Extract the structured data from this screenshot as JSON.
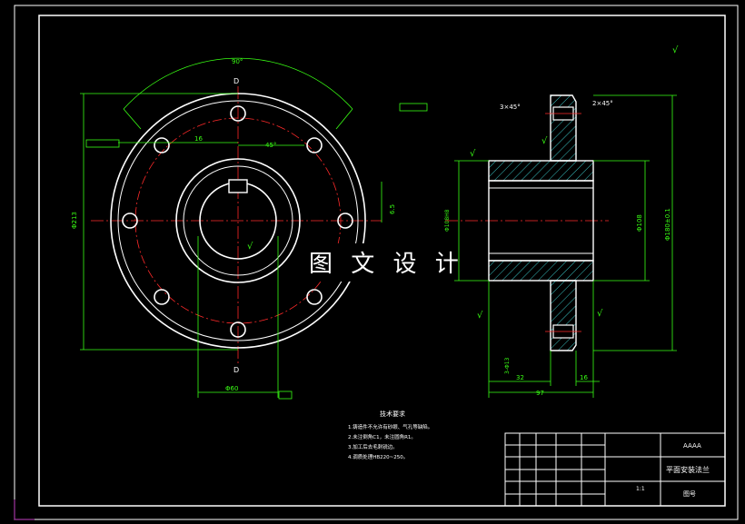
{
  "watermark": "图 文 设 计",
  "front_view": {
    "angle_label": "90°",
    "bolt_angle_label": "45°",
    "outer_dia_label": "Φ213",
    "bolt_circle_label": "Φ60",
    "pitch_label": "16",
    "keyway_label": "6.5",
    "section_mark": "D"
  },
  "side_view": {
    "chamfer_left": "3×45°",
    "chamfer_right": "2×45°",
    "dia_mid": "Φ108",
    "dia_right": "Φ180±0.1",
    "dia_left": "Φ108H8",
    "hole_label": "3-Φ13",
    "dim_width": "32",
    "dim_total": "97",
    "dim_flange": "16"
  },
  "notes": {
    "heading": "技术要求",
    "lines": [
      "1.铸造件不允许有砂眼、气孔等缺陷。",
      "2.未注倒角C1，未注圆角R1。",
      "3.加工后去毛刺锐边。",
      "4.调质处理HB220~250。"
    ]
  },
  "title_block": {
    "part_name": "平面安装法兰",
    "scale": "1:1",
    "drawing_no": "图号",
    "company": "AAAA"
  },
  "roughness_symbol": "√"
}
